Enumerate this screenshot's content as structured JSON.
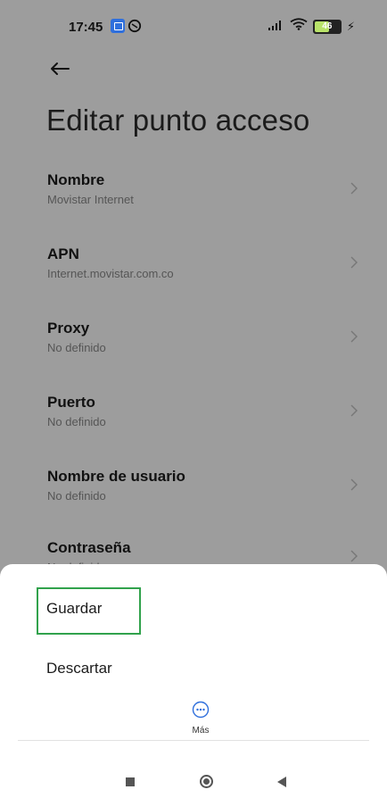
{
  "status_bar": {
    "time": "17:45",
    "battery_level": "46",
    "icons": [
      "calendar-icon",
      "alarm-icon",
      "signal-icon",
      "wifi-icon",
      "battery-icon",
      "charging-icon"
    ]
  },
  "header": {
    "back_icon": "arrow-left-icon",
    "title": "Editar punto acceso"
  },
  "settings": {
    "items": [
      {
        "label": "Nombre",
        "value": "Movistar Internet"
      },
      {
        "label": "APN",
        "value": "Internet.movistar.com.co"
      },
      {
        "label": "Proxy",
        "value": "No definido"
      },
      {
        "label": "Puerto",
        "value": "No definido"
      },
      {
        "label": "Nombre de usuario",
        "value": "No definido"
      },
      {
        "label": "Contraseña",
        "value": "No definido"
      }
    ]
  },
  "sheet": {
    "save_label": "Guardar",
    "discard_label": "Descartar",
    "more_label": "Más"
  },
  "colors": {
    "highlight": "#31a24c",
    "more_icon": "#2f6fdc",
    "battery_fill": "#b9e36a"
  }
}
